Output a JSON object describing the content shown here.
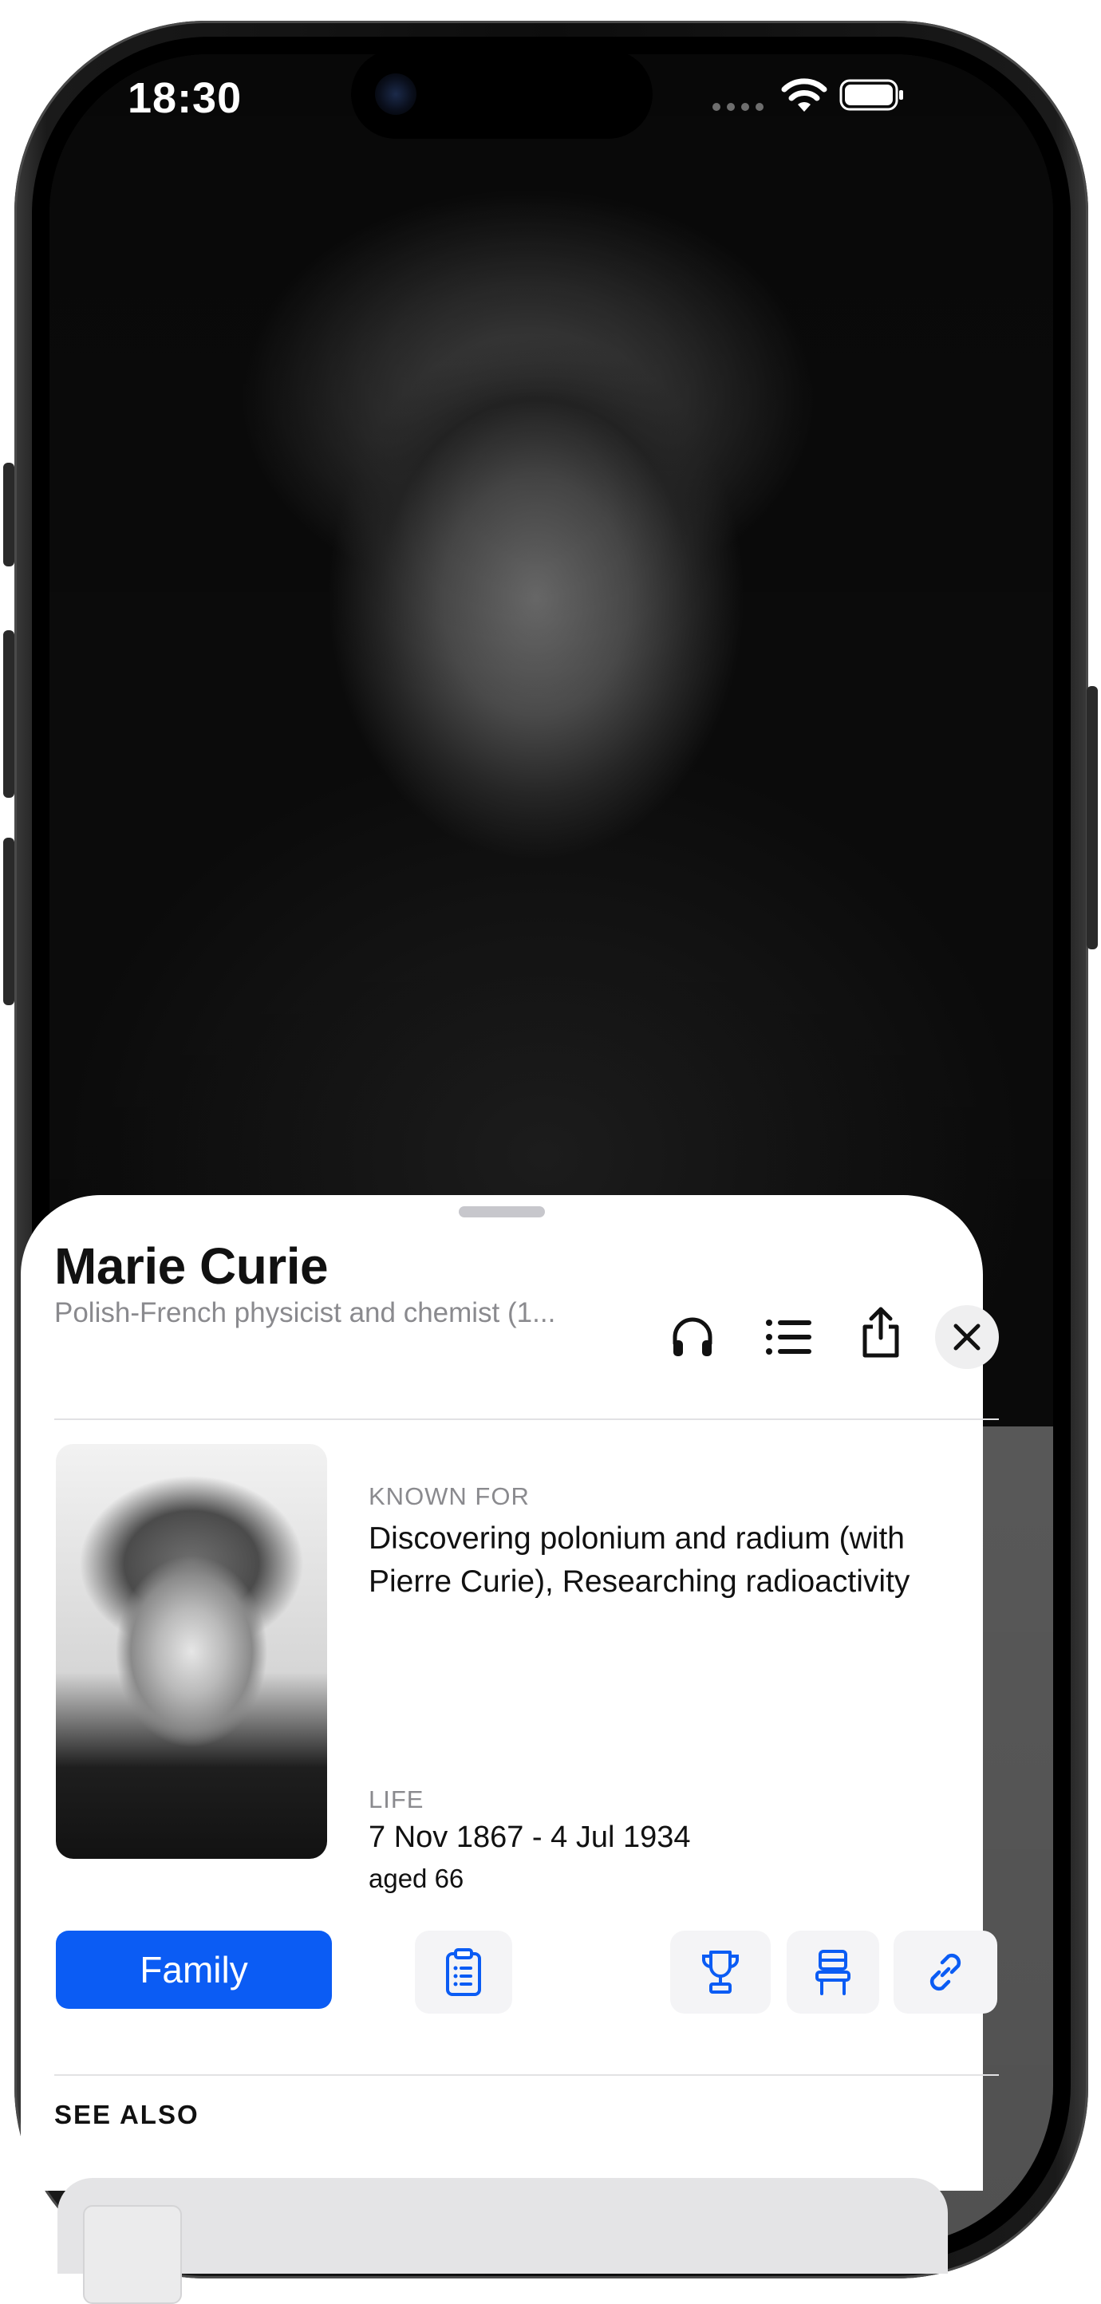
{
  "status_bar": {
    "time": "18:30"
  },
  "sheet": {
    "title": "Marie Curie",
    "subtitle": "Polish-French physicist and chemist (1...",
    "header_icons": [
      "headphones-icon",
      "list-icon",
      "share-icon",
      "close-icon"
    ],
    "known_for_label": "KNOWN FOR",
    "known_for_text": "Discovering polonium and radium (with Pierre Curie), Researching radioactivity",
    "life_label": "LIFE",
    "life_dates": "7 Nov 1867 - 4 Jul 1934",
    "life_age": "aged 66",
    "family_button": "Family",
    "action_icons": [
      "clipboard-icon",
      "trophy-icon",
      "chair-icon",
      "link-icon"
    ],
    "see_also_label": "SEE ALSO"
  },
  "colors": {
    "accent": "#0b5cf4",
    "sheet_bg": "#ffffff",
    "secondary_text": "#8a8a8e"
  }
}
